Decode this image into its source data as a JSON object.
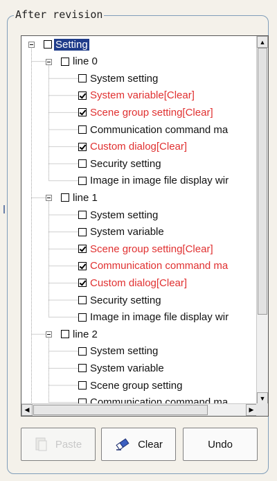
{
  "group": {
    "title": "After revision"
  },
  "tree": {
    "root": {
      "label": "Setting",
      "selected": true,
      "checked": false
    },
    "lines": [
      {
        "label": "line 0",
        "checked": false,
        "items": [
          {
            "label": "System setting",
            "checked": false,
            "modified": false
          },
          {
            "label": "System variable[Clear]",
            "checked": true,
            "modified": true
          },
          {
            "label": "Scene group setting[Clear]",
            "checked": true,
            "modified": true
          },
          {
            "label": "Communication command ma",
            "checked": false,
            "modified": false
          },
          {
            "label": "Custom dialog[Clear]",
            "checked": true,
            "modified": true
          },
          {
            "label": "Security setting",
            "checked": false,
            "modified": false
          },
          {
            "label": "Image in image file display wir",
            "checked": false,
            "modified": false
          }
        ]
      },
      {
        "label": "line 1",
        "checked": false,
        "items": [
          {
            "label": "System setting",
            "checked": false,
            "modified": false
          },
          {
            "label": "System variable",
            "checked": false,
            "modified": false
          },
          {
            "label": "Scene group setting[Clear]",
            "checked": true,
            "modified": true
          },
          {
            "label": "Communication command ma",
            "checked": true,
            "modified": true
          },
          {
            "label": "Custom dialog[Clear]",
            "checked": true,
            "modified": true
          },
          {
            "label": "Security setting",
            "checked": false,
            "modified": false
          },
          {
            "label": "Image in image file display wir",
            "checked": false,
            "modified": false
          }
        ]
      },
      {
        "label": "line 2",
        "checked": false,
        "items": [
          {
            "label": "System setting",
            "checked": false,
            "modified": false
          },
          {
            "label": "System variable",
            "checked": false,
            "modified": false
          },
          {
            "label": "Scene group setting",
            "checked": false,
            "modified": false
          },
          {
            "label": "Communication command ma",
            "checked": false,
            "modified": false
          }
        ]
      }
    ]
  },
  "buttons": {
    "paste": {
      "label": "Paste",
      "icon": "paste-icon",
      "enabled": false
    },
    "clear": {
      "label": "Clear",
      "icon": "eraser-icon",
      "enabled": true
    },
    "undo": {
      "label": "Undo",
      "enabled": true
    }
  },
  "colors": {
    "modified": "#e03030",
    "selection": "#1f3c8a"
  }
}
